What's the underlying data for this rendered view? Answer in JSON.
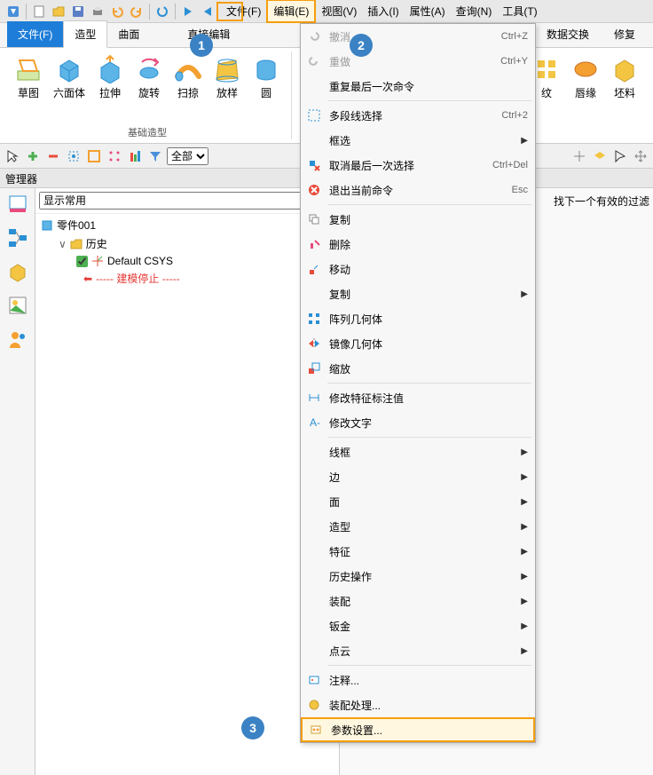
{
  "menu": {
    "file": "文件(F)",
    "edit": "编辑(E)",
    "view": "视图(V)",
    "insert": "插入(I)",
    "attr": "属性(A)",
    "query": "查询(N)",
    "tool": "工具(T)"
  },
  "ribbon_tabs": {
    "file": "文件(F)",
    "modeling": "造型",
    "surface": "曲面",
    "direct_edit": "直接编辑",
    "data_exchange": "数据交换",
    "repair": "修复"
  },
  "ribbon_buttons": {
    "sketch": "草图",
    "hexahedron": "六面体",
    "extrude": "拉伸",
    "rotate": "旋转",
    "sweep": "扫掠",
    "loft": "放样",
    "cylinder": "圆",
    "pattern": "纹",
    "lip": "唇缘",
    "blank": "坯料",
    "group_basic": "基础造型"
  },
  "toolbar_mid": {
    "filter_all": "全部"
  },
  "manager": {
    "title": "管理器"
  },
  "tree": {
    "display_common": "显示常用",
    "part_node": "零件001",
    "history": "历史",
    "default_csys": "Default CSYS",
    "modeling_stop": "----- 建模停止 -----"
  },
  "canvas": {
    "msg": "找下一个有效的过滤"
  },
  "edit_menu": {
    "undo": "撤消",
    "undo_key": "Ctrl+Z",
    "redo": "重做",
    "redo_key": "Ctrl+Y",
    "redo_last": "重复最后一次命令",
    "polyline_sel": "多段线选择",
    "polyline_key": "Ctrl+2",
    "box_sel": "框选",
    "cancel_last_sel": "取消最后一次选择",
    "cancel_key": "Ctrl+Del",
    "exit_cmd": "退出当前命令",
    "exit_key": "Esc",
    "duplicate": "复制",
    "delete": "删除",
    "move": "移动",
    "copy": "复制",
    "pattern_geom": "阵列几何体",
    "mirror_geom": "镜像几何体",
    "scale": "缩放",
    "modify_feature_annot": "修改特征标注值",
    "modify_text": "修改文字",
    "wireframe": "线框",
    "edge": "边",
    "face": "面",
    "shape": "造型",
    "feature": "特征",
    "history_op": "历史操作",
    "assembly": "装配",
    "sheetmetal": "钣金",
    "pointcloud": "点云",
    "annotation": "注释...",
    "assembly_process": "装配处理...",
    "param_settings": "参数设置..."
  },
  "annotations": {
    "one": "1",
    "two": "2",
    "three": "3"
  }
}
